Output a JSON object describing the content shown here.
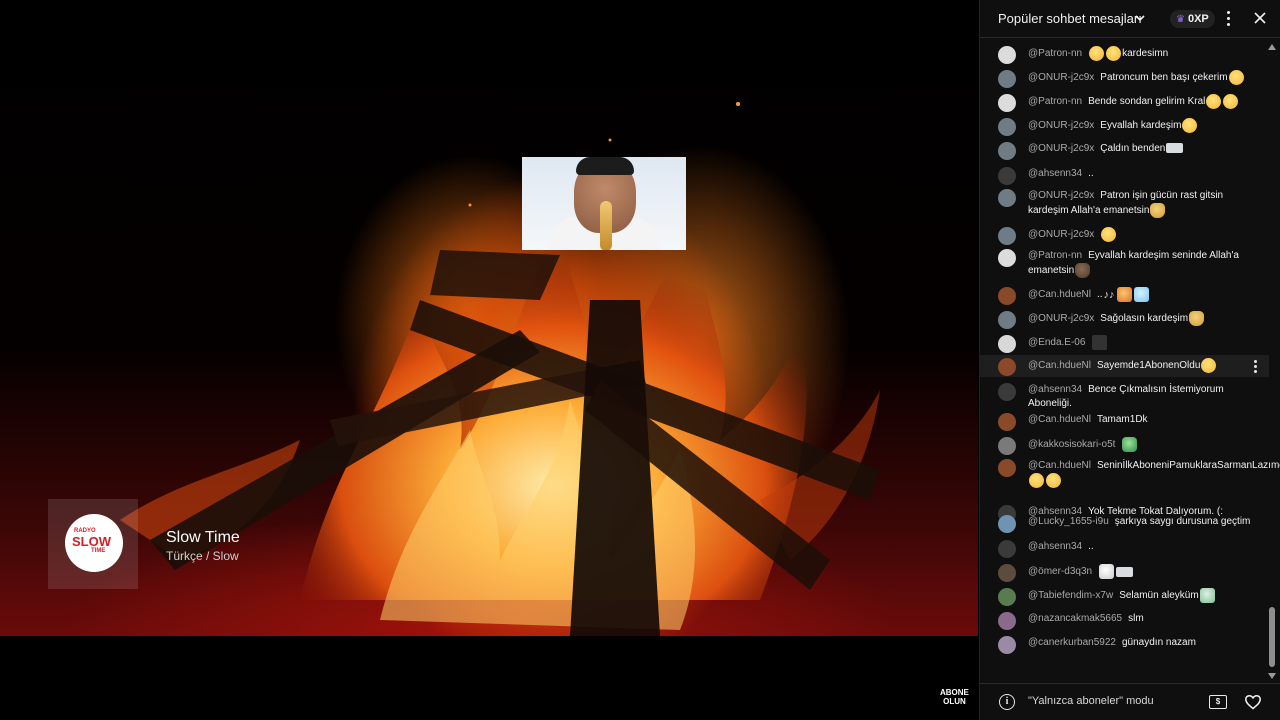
{
  "video": {
    "channel_logo": {
      "brand": "RADYO",
      "name": "SLOW",
      "tag": "TIME"
    },
    "title": "Slow Time",
    "subtitle": "Türkçe / Slow",
    "subscribe_label_1": "ABONE",
    "subscribe_label_2": "OLUN"
  },
  "chat": {
    "header": {
      "title": "Popüler sohbet mesajları",
      "xp": "0XP"
    },
    "messages": [
      {
        "author": "@Patron-nn",
        "text": "kardesimn",
        "emoji_before": [
          "laugh",
          "laugh"
        ],
        "emoji_after": []
      },
      {
        "author": "@ONUR-j2c9x",
        "text": "Patroncum ben başı çekerim",
        "emoji_before": [],
        "emoji_after": [
          "grin"
        ]
      },
      {
        "author": "@Patron-nn",
        "text": "Bende sondan gelirim Kral",
        "emoji_before": [],
        "emoji_after": [
          "laugh",
          "laugh"
        ]
      },
      {
        "author": "@ONUR-j2c9x",
        "text": "Eyvallah kardeşim",
        "emoji_before": [],
        "emoji_after": [
          "grin"
        ]
      },
      {
        "author": "@ONUR-j2c9x",
        "text": "Çaldın benden",
        "emoji_before": [],
        "emoji_after": [
          "smoke"
        ]
      },
      {
        "author": "@ahsenn34",
        "text": "..",
        "emoji_before": [],
        "emoji_after": []
      },
      {
        "author": "@ONUR-j2c9x",
        "text": "Patron işin gücün rast gitsin kardeşim Allah'a emanetsin",
        "emoji_before": [],
        "emoji_after": [
          "wave"
        ]
      },
      {
        "author": "@ONUR-j2c9x",
        "text": "",
        "emoji_before": [],
        "emoji_after": [
          "grin"
        ]
      },
      {
        "author": "@Patron-nn",
        "text": "Eyvallah kardeşim seninde Allah'a emanetsin",
        "emoji_before": [],
        "emoji_after": [
          "wave-dark"
        ]
      },
      {
        "author": "@Can.hdueNl",
        "text": "..",
        "emoji_before": [],
        "emoji_after": [
          "notes",
          "whisky",
          "ice"
        ]
      },
      {
        "author": "@ONUR-j2c9x",
        "text": "Sağolasın kardeşim",
        "emoji_before": [],
        "emoji_after": [
          "handshake"
        ]
      },
      {
        "author": "@Enda.E-06",
        "text": "",
        "emoji_before": [],
        "emoji_after": [
          "pirate-flag"
        ]
      },
      {
        "author": "@Can.hdueNl",
        "text": "Sayemde1AbonenOldu",
        "emoji_before": [],
        "emoji_after": [
          "grin"
        ]
      },
      {
        "author": "@ahsenn34",
        "text": "Bence Çıkmalısın İstemiyorum Aboneliği.",
        "emoji_before": [],
        "emoji_after": []
      },
      {
        "author": "@Can.hdueNl",
        "text": "Tamam1Dk",
        "emoji_before": [],
        "emoji_after": []
      },
      {
        "author": "@kakkosisokari-o5t",
        "text": "",
        "emoji_before": [],
        "emoji_after": [
          "island"
        ]
      },
      {
        "author": "@Can.hdueNl",
        "text": "SeninİlkAboneniPamuklaraSarmanLazımdı",
        "emoji_before": [],
        "emoji_after": [
          "grin",
          "grin"
        ]
      },
      {
        "author": "@ahsenn34",
        "text": "Yok Tekme Tokat Dalıyorum. (:",
        "emoji_before": [],
        "emoji_after": []
      },
      {
        "author": "@Lucky_1655-i9u",
        "text": "şarkıya saygı durusuna geçtim",
        "emoji_before": [],
        "emoji_after": []
      },
      {
        "author": "@ahsenn34",
        "text": "..",
        "emoji_before": [],
        "emoji_after": []
      },
      {
        "author": "@ömer-d3q3n",
        "text": "",
        "emoji_before": [],
        "emoji_after": [
          "coffee",
          "smoke"
        ]
      },
      {
        "author": "@Tabiefendim-x7w",
        "text": "Selamün aleyküm",
        "emoji_before": [],
        "emoji_after": [
          "teacher"
        ]
      },
      {
        "author": "@nazancakmak5665",
        "text": "slm",
        "emoji_before": [],
        "emoji_after": []
      },
      {
        "author": "@canerkurban5922",
        "text": "günaydın nazam",
        "emoji_before": [],
        "emoji_after": []
      }
    ],
    "footer": {
      "mode_label": "\"Yalnızca aboneler\" modu"
    }
  },
  "colors": {
    "panel_bg": "#0f0f0f",
    "author_color": "#aaaaaa",
    "text_color": "#f1f1f1",
    "xp_crown": "#9b6cff"
  }
}
